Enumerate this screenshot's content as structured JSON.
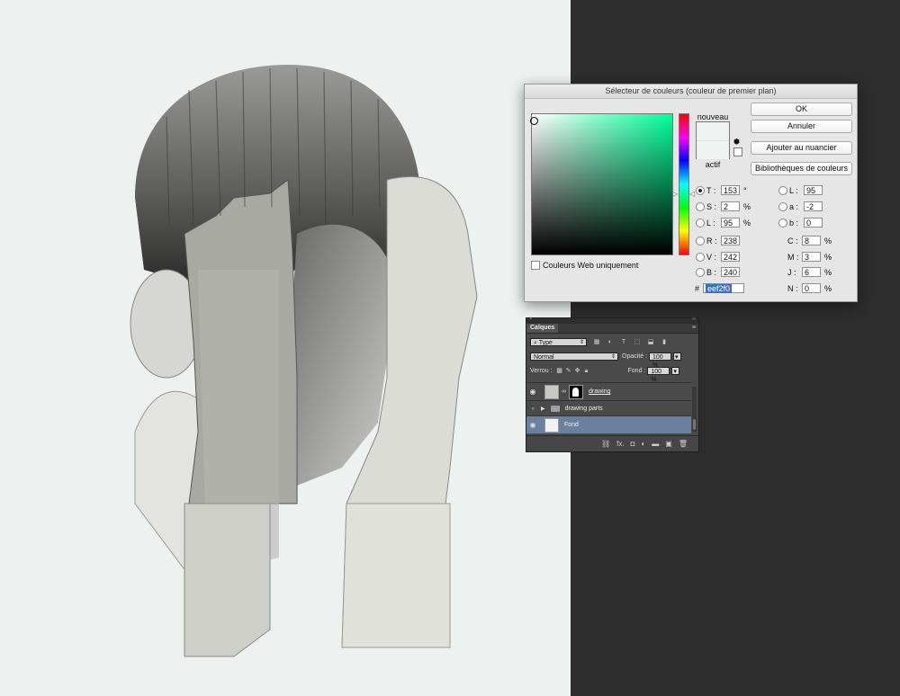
{
  "picker": {
    "title": "Sélecteur de couleurs (couleur de premier plan)",
    "new_label": "nouveau",
    "current_label": "actif",
    "new_color": "#eef2f0",
    "current_color": "#eef2f0",
    "ok_label": "OK",
    "cancel_label": "Annuler",
    "add_swatch_label": "Ajouter au nuancier",
    "libraries_label": "Bibliothèques de couleurs",
    "web_only_label": "Couleurs Web uniquement",
    "hue_field_color": "#00ff99",
    "fields_left": [
      {
        "label": "T :",
        "value": "153",
        "unit": "°"
      },
      {
        "label": "S :",
        "value": "2",
        "unit": "%"
      },
      {
        "label": "L :",
        "value": "95",
        "unit": "%"
      },
      {
        "label": "R :",
        "value": "238",
        "unit": ""
      },
      {
        "label": "V :",
        "value": "242",
        "unit": ""
      },
      {
        "label": "B :",
        "value": "240",
        "unit": ""
      }
    ],
    "fields_lab": [
      {
        "label": "L :",
        "value": "95"
      },
      {
        "label": "a :",
        "value": "-2"
      },
      {
        "label": "b :",
        "value": "0"
      }
    ],
    "fields_cmyk": [
      {
        "label": "C :",
        "value": "8",
        "unit": "%"
      },
      {
        "label": "M :",
        "value": "3",
        "unit": "%"
      },
      {
        "label": "J :",
        "value": "6",
        "unit": "%"
      },
      {
        "label": "N :",
        "value": "0",
        "unit": "%"
      }
    ],
    "hex_label": "#",
    "hex_value": "eef2f0"
  },
  "layers": {
    "top_close": "×",
    "top_collapse": "‹‹",
    "tab_label": "Calques",
    "menu_icon": "≡",
    "filter_label": "Type",
    "blend_mode": "Normal",
    "opacity_label": "Opacité :",
    "opacity_value": "100 %",
    "lock_label": "Verrou :",
    "fill_label": "Fond :",
    "fill_value": "100 %",
    "items": [
      {
        "name": "drawing"
      },
      {
        "name": "drawing parts"
      },
      {
        "name": "Fond"
      }
    ]
  },
  "colors": {
    "canvas_bg": "#edf1f0",
    "workspace_bg": "#2d2d2d",
    "selected_layer": "#69809e"
  }
}
